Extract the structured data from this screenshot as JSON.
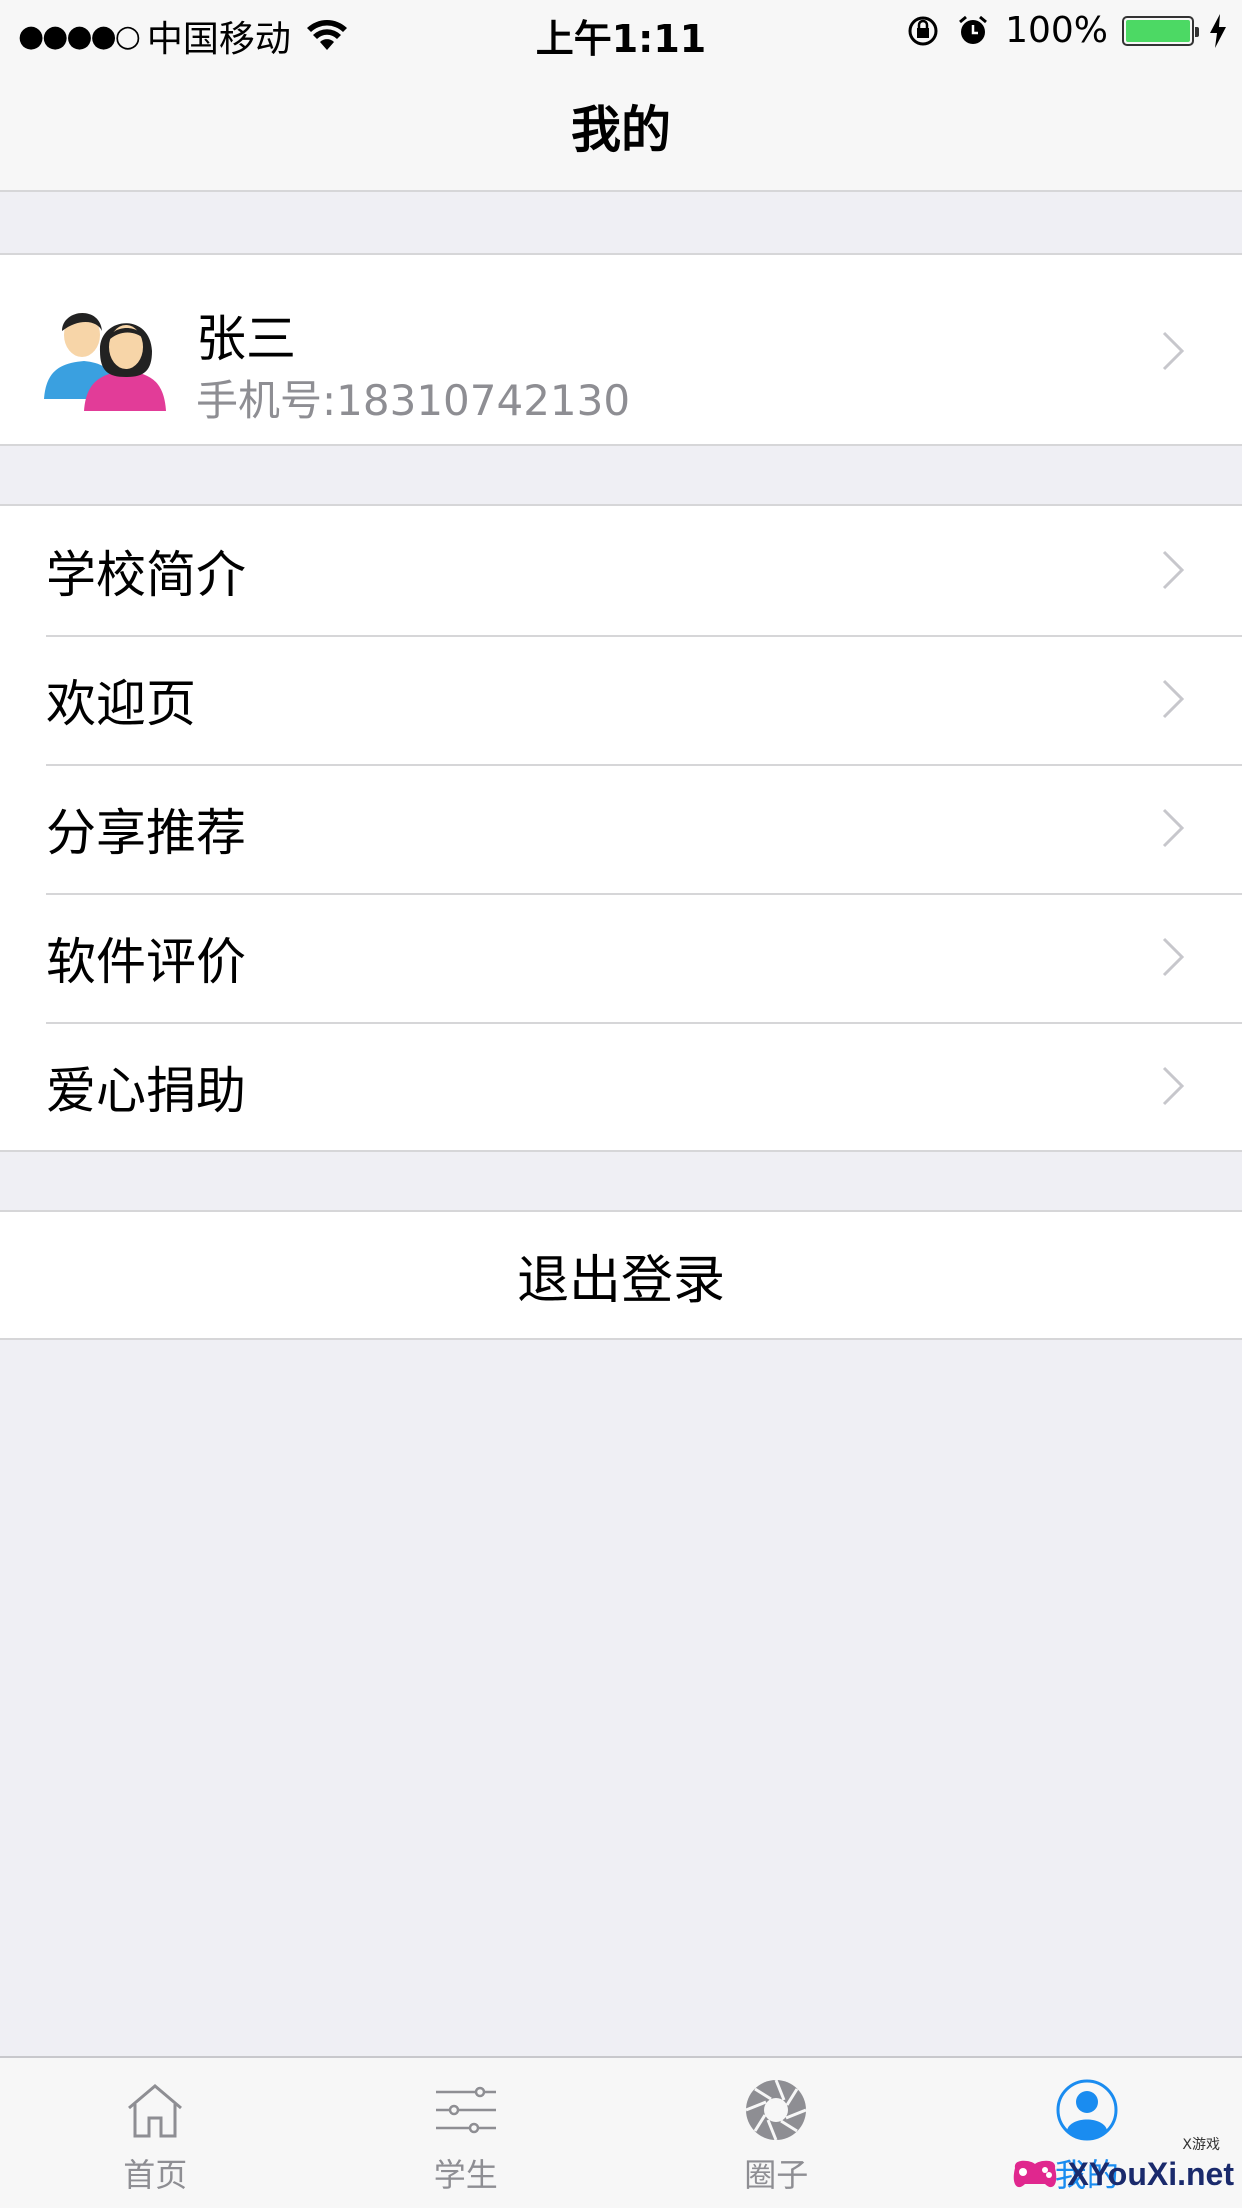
{
  "status_bar": {
    "signal": "●●●●○",
    "carrier": "中国移动",
    "time": "上午1:11",
    "battery_percent": "100%",
    "battery_level": 1.0
  },
  "nav": {
    "title": "我的"
  },
  "profile": {
    "name": "张三",
    "phone": "手机号:18310742130"
  },
  "menu": {
    "items": [
      {
        "label": "学校简介"
      },
      {
        "label": "欢迎页"
      },
      {
        "label": "分享推荐"
      },
      {
        "label": "软件评价"
      },
      {
        "label": "爱心捐助"
      }
    ]
  },
  "logout": {
    "label": "退出登录"
  },
  "tabbar": {
    "items": [
      {
        "label": "首页",
        "icon": "home-icon"
      },
      {
        "label": "学生",
        "icon": "sliders-icon"
      },
      {
        "label": "圈子",
        "icon": "aperture-icon"
      },
      {
        "label": "我的",
        "icon": "user-icon",
        "active": true
      }
    ],
    "active_color": "#1a8cf0"
  },
  "watermark": {
    "text": "XYouXi.net",
    "small": "X游戏"
  }
}
